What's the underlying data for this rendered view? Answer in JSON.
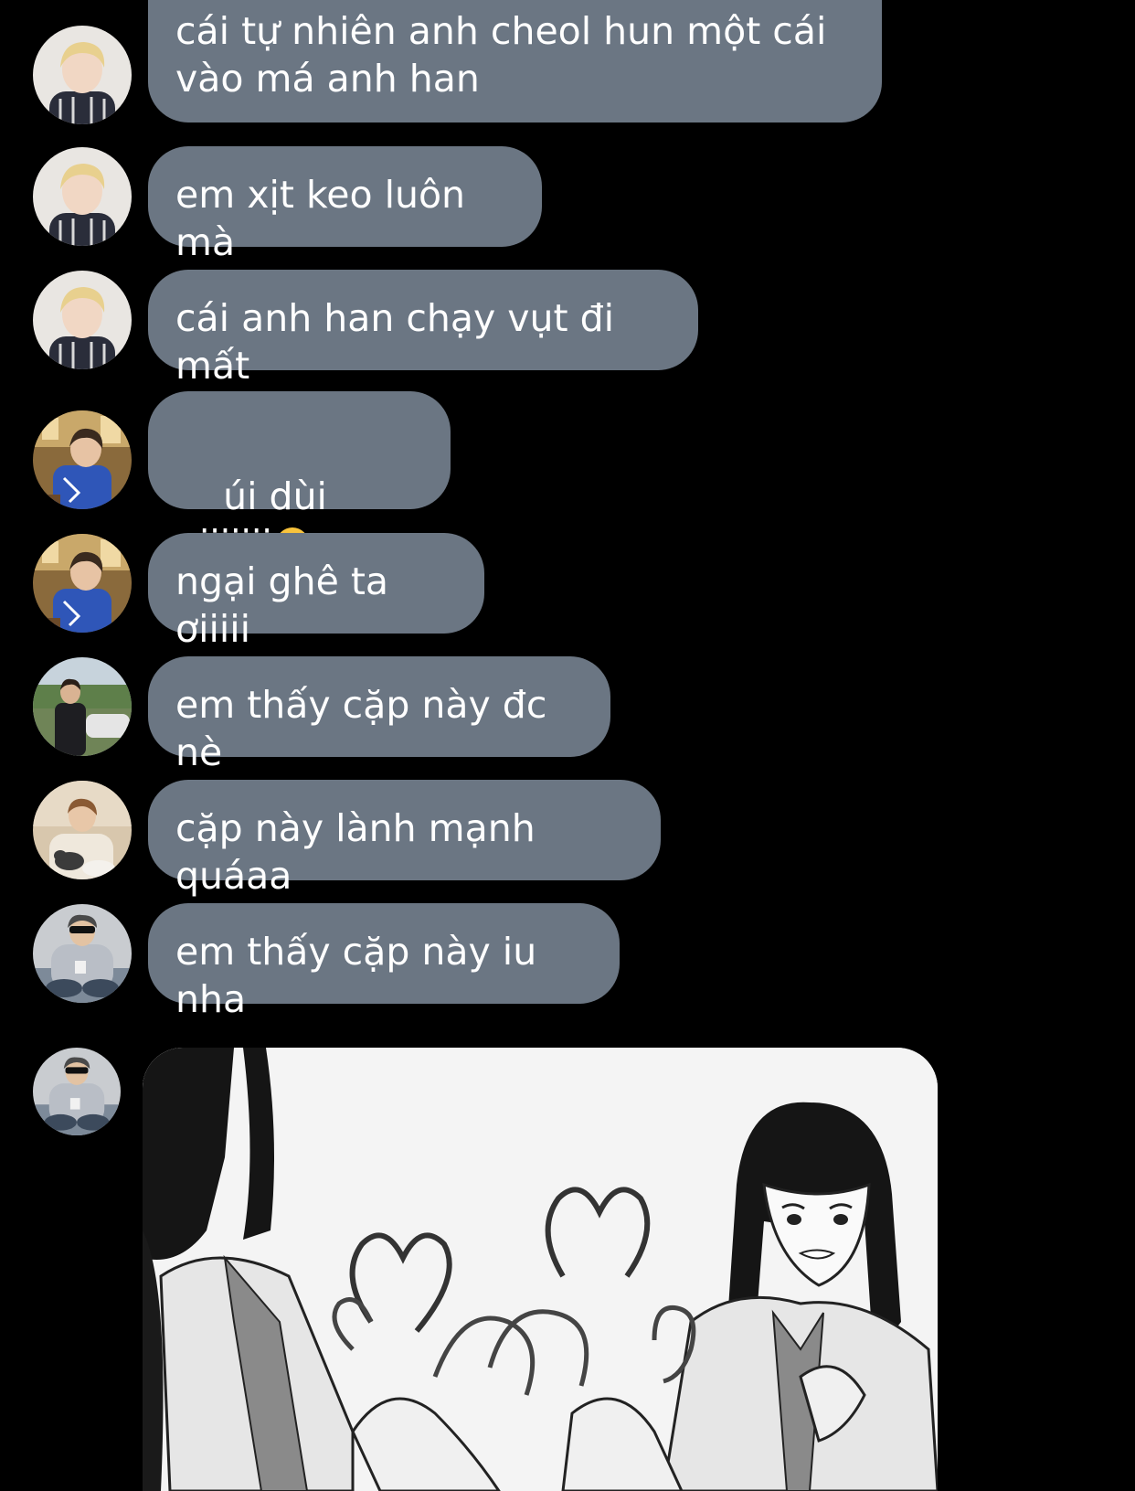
{
  "messages": [
    {
      "text": "cái tự nhiên anh cheol hun một cái\nvào má anh han",
      "avatar": "blonde-person-avatar"
    },
    {
      "text": "em xịt keo luôn mà",
      "avatar": "blonde-person-avatar"
    },
    {
      "text": "cái anh han chạy vụt đi mất",
      "avatar": "blonde-person-avatar"
    },
    {
      "text": "úi dùi uiiiiiii",
      "emoji": "hand-over-mouth-emoji",
      "avatar": "blue-shirt-person-avatar"
    },
    {
      "text": "ngại ghê ta ơiiiii",
      "avatar": "blue-shirt-person-avatar"
    },
    {
      "text": "em thấy cặp này đc nè",
      "avatar": "outdoor-person-avatar"
    },
    {
      "text": "cặp này lành mạnh quáaa",
      "avatar": "person-with-cat-avatar"
    },
    {
      "text": "em thấy cặp này iu nha",
      "avatar": "sunglasses-person-avatar"
    }
  ],
  "image_message": {
    "avatar": "sunglasses-person-avatar",
    "image": "manga-heart-hands-image"
  },
  "colors": {
    "background": "#000000",
    "bubble": "#6b7683",
    "text": "#ffffff"
  }
}
